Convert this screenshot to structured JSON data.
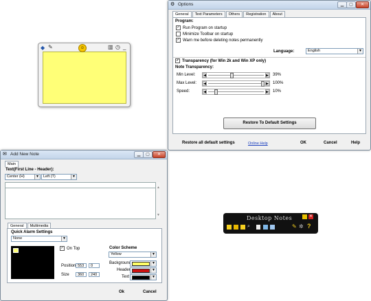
{
  "options": {
    "title": "Options",
    "tabs": [
      "General",
      "Text Parameters",
      "Others",
      "Registration",
      "About"
    ],
    "program_label": "Program:",
    "checks": [
      {
        "label": "Run Program on startup",
        "checked": true
      },
      {
        "label": "Minimize Toolbar on startup",
        "checked": false
      },
      {
        "label": "Warn me before deleting notes permanently",
        "checked": true
      }
    ],
    "language_label": "Language:",
    "language_value": "English",
    "transparency_label": "Transparency (for Win 2k and Win XP only)",
    "transparency_checked": true,
    "note_transparency_label": "Note Transparency:",
    "sliders": [
      {
        "label": "Min Level:",
        "value": "39%",
        "level": 0.39
      },
      {
        "label": "Max Level:",
        "value": "100%",
        "level": 1.0
      },
      {
        "label": "Speed:",
        "value": "10%",
        "level": 0.1
      }
    ],
    "restore_button": "Restore To Default Settings",
    "footer": {
      "restore_all": "Restore all default settings",
      "online_help": "Online Help",
      "ok": "OK",
      "cancel": "Cancel",
      "help": "Help"
    }
  },
  "add_note": {
    "title": "Add New Note",
    "main_tab": "Main",
    "text_header_label": "Text(First Line - Header):",
    "align_v": "Center (H)",
    "align_h": "Left (T)",
    "bottom_tabs": [
      "General",
      "Multimedia"
    ],
    "quick_alarm_label": "Quick Alarm Settings",
    "alarm_value": "None",
    "on_top_label": "On Top",
    "on_top_checked": true,
    "position_label": "Position",
    "position_x": "553",
    "position_y": "0",
    "size_label": "Size",
    "size_w": "360",
    "size_h": "240",
    "color_scheme_label": "Color Scheme",
    "color_scheme_value": "Yellow",
    "background_label": "Background",
    "header_label": "Header",
    "text_label": "Text",
    "colors": {
      "background": "#ffff66",
      "header": "#cc1111",
      "text": "#000000",
      "sticky": "#ffff77"
    },
    "ok": "Ok",
    "cancel": "Cancel"
  },
  "toolbar": {
    "title": "Desktop Notes"
  }
}
